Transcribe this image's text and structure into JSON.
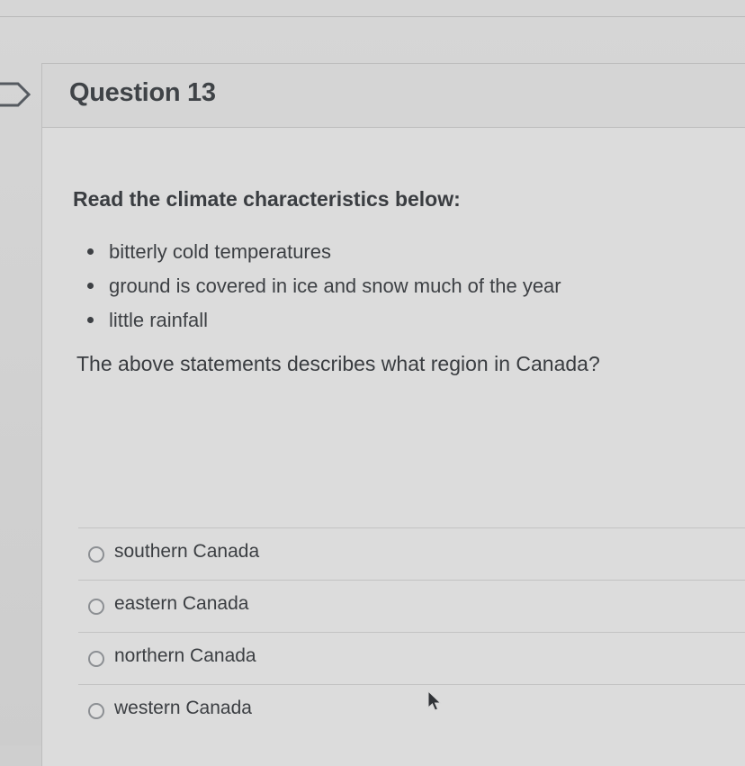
{
  "question": {
    "title": "Question 13",
    "prompt": "Read the climate characteristics below:",
    "characteristics": [
      "bitterly cold temperatures",
      "ground is covered in ice and snow much of the year",
      "little rainfall"
    ],
    "statement": "The above statements describes what region in Canada?"
  },
  "answers": [
    {
      "label": "southern Canada",
      "selected": false
    },
    {
      "label": "eastern Canada",
      "selected": false
    },
    {
      "label": "northern Canada",
      "selected": false
    },
    {
      "label": "western Canada",
      "selected": false
    }
  ],
  "icons": {
    "bookmark": "bookmark-flag-icon",
    "radio": "radio-unselected-icon",
    "cursor": "mouse-pointer-icon"
  }
}
